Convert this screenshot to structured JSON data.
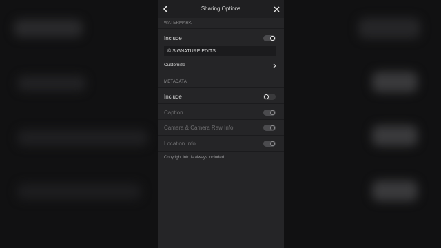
{
  "header": {
    "title": "Sharing Options"
  },
  "watermark": {
    "section_label": "WATERMARK",
    "include_label": "Include",
    "include_on": true,
    "text_value": "© SIGNATURE EDITS",
    "customize_label": "Customize"
  },
  "metadata": {
    "section_label": "METADATA",
    "include_label": "Include",
    "include_on": false,
    "caption_label": "Caption",
    "camera_label": "Camera & Camera Raw Info",
    "location_label": "Location Info",
    "note": "Copyright info is always included"
  },
  "icons": {
    "back": "chevron-left-icon",
    "close": "close-icon",
    "customize": "chevron-right-icon"
  }
}
